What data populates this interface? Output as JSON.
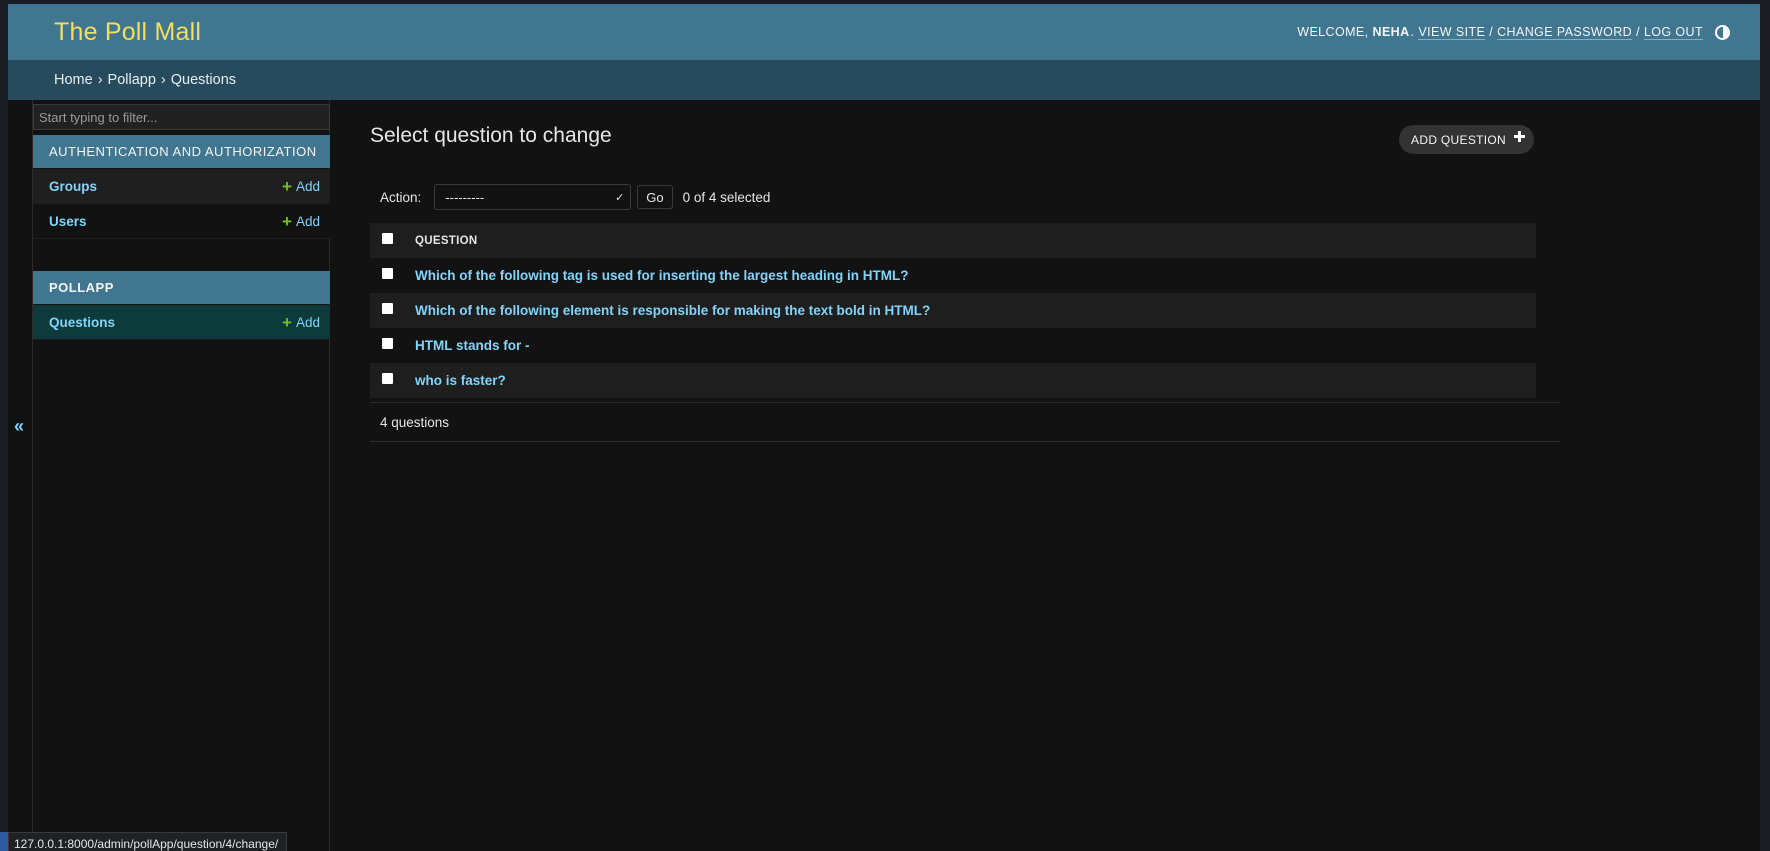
{
  "header": {
    "site_name": "The Poll Mall",
    "welcome": "WELCOME,",
    "username": "NEHA",
    "view_site": "VIEW SITE",
    "change_password": "CHANGE PASSWORD",
    "log_out": "LOG OUT",
    "separator": "/"
  },
  "breadcrumbs": {
    "items": [
      "Home",
      "Pollapp",
      "Questions"
    ],
    "separator": "›"
  },
  "sidebar": {
    "filter_placeholder": "Start typing to filter...",
    "collapse_icon": "«",
    "modules": [
      {
        "caption": "AUTHENTICATION AND AUTHORIZATION",
        "models": [
          {
            "name": "Groups",
            "add": "Add"
          },
          {
            "name": "Users",
            "add": "Add"
          }
        ]
      },
      {
        "caption": "POLLAPP",
        "models": [
          {
            "name": "Questions",
            "add": "Add"
          }
        ]
      }
    ]
  },
  "main": {
    "title": "Select question to change",
    "add_button": "ADD QUESTION",
    "action_label": "Action:",
    "action_selected": "---------",
    "go_button": "Go",
    "selected_count": "0 of 4 selected",
    "column_header": "QUESTION",
    "rows": [
      "Which of the following tag is used for inserting the largest heading in HTML?",
      "Which of the following element is responsible for making the text bold in HTML?",
      "HTML stands for -",
      "who is faster?"
    ],
    "paginator": "4 questions"
  },
  "status_bar": {
    "url": "127.0.0.1:8000/admin/pollApp/question/4/change/"
  },
  "colors": {
    "header_bg": "#417690",
    "breadcrumbs_bg": "#264b5d",
    "brand": "#f5dd5d",
    "link": "#81d4fa",
    "add_icon": "#70bf2b",
    "body_bg": "#121212"
  }
}
